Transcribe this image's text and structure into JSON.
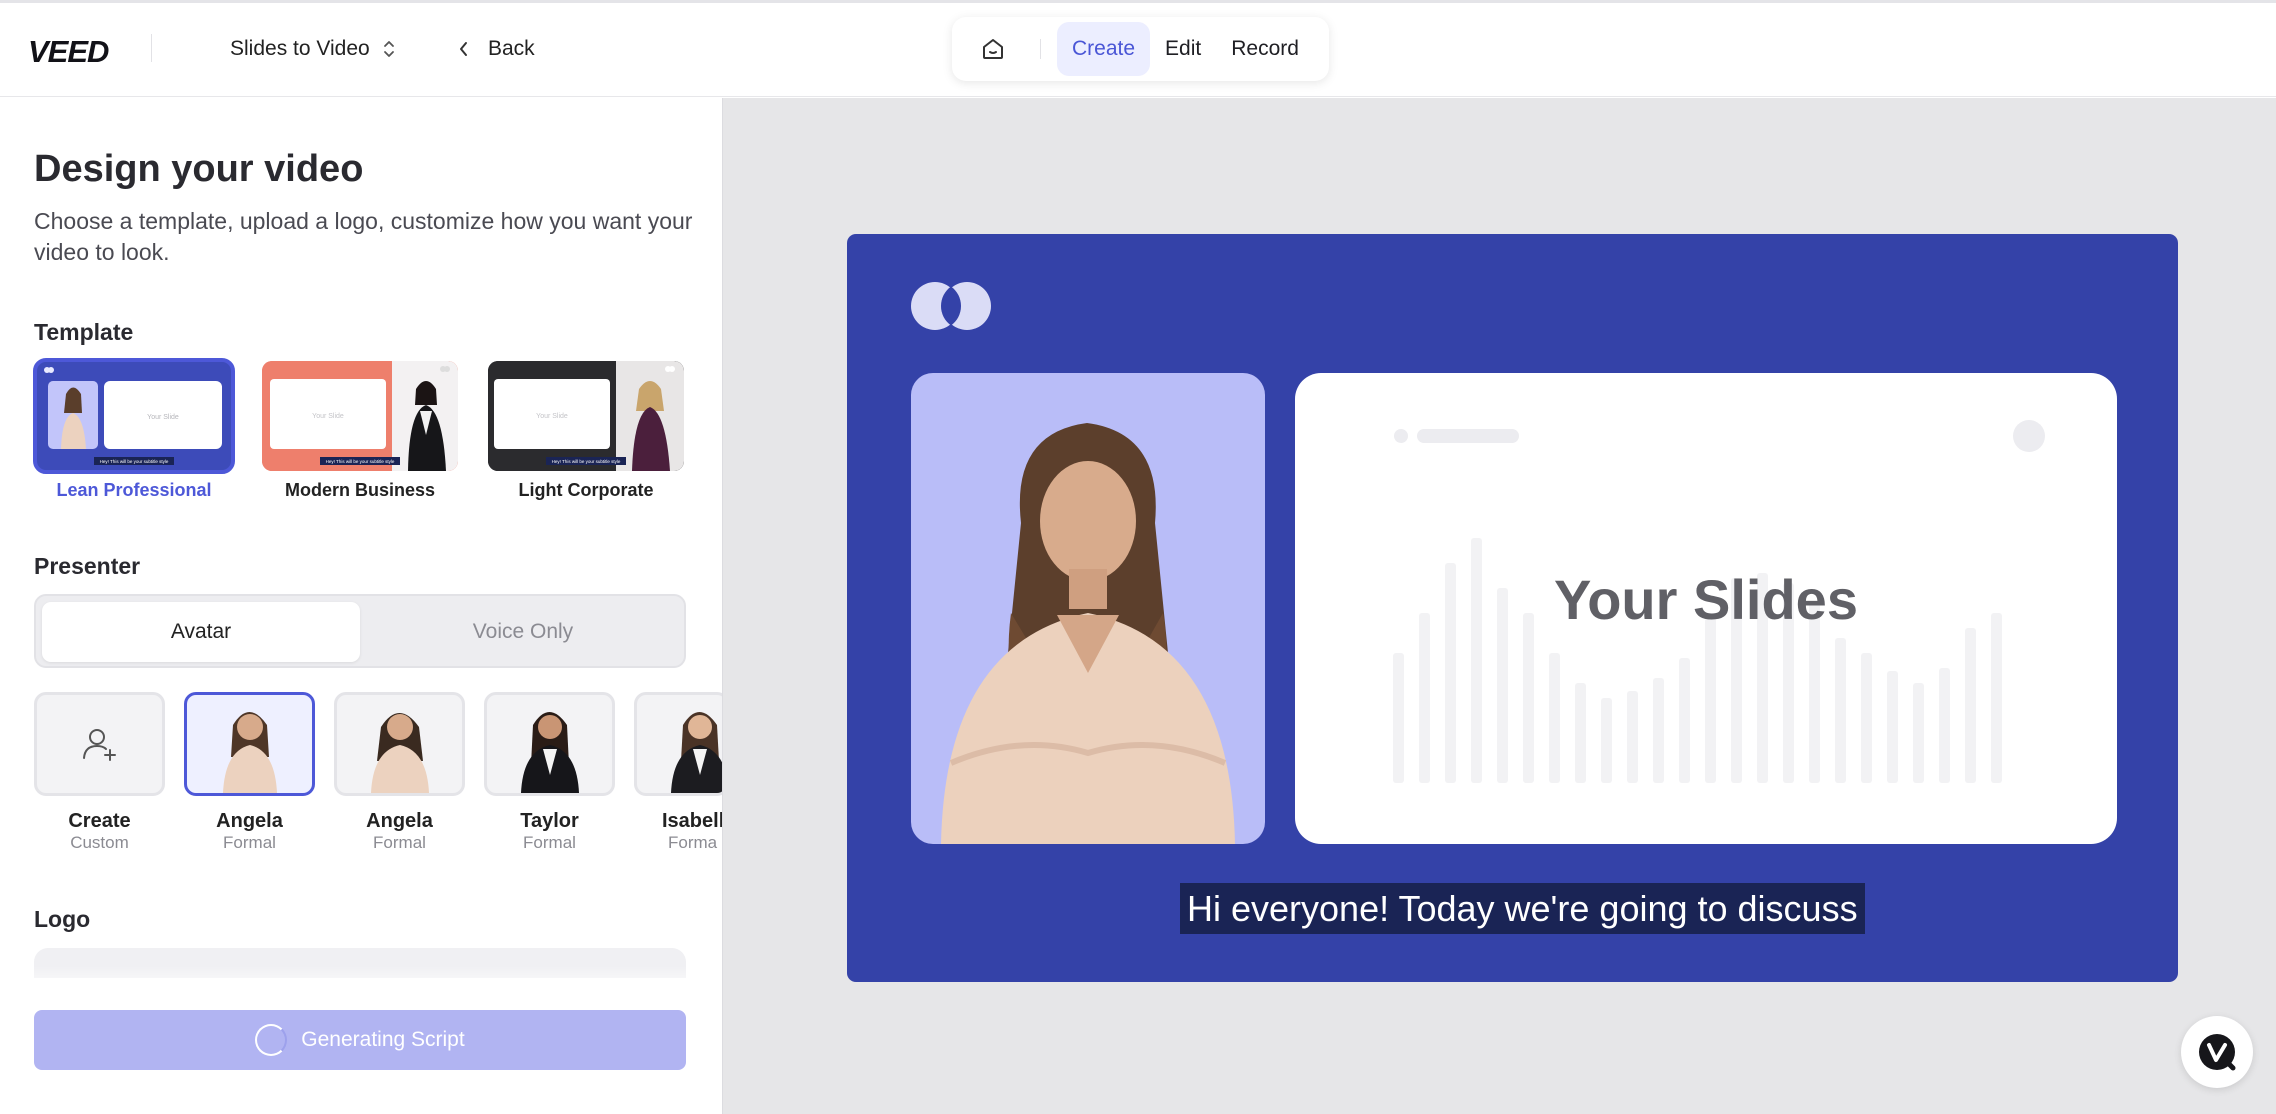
{
  "topbar": {
    "brand": "VEED",
    "project_name": "Slides to Video",
    "back_label": "Back",
    "modes": [
      {
        "label": "Create",
        "active": true
      },
      {
        "label": "Edit",
        "active": false
      },
      {
        "label": "Record",
        "active": false
      }
    ]
  },
  "panel": {
    "title": "Design your video",
    "subtitle": "Choose a template, upload a logo, customize how you want your video to look.",
    "template_heading": "Template",
    "templates": [
      {
        "label": "Lean Professional",
        "selected": true,
        "slide_text": "Your Slide"
      },
      {
        "label": "Modern Business",
        "selected": false,
        "slide_text": "Your Slide"
      },
      {
        "label": "Light Corporate",
        "selected": false,
        "slide_text": "Your Slide"
      }
    ],
    "presenter_heading": "Presenter",
    "presenter_modes": [
      "Avatar",
      "Voice Only"
    ],
    "presenter_mode_selected": "Avatar",
    "avatars": [
      {
        "name": "Create",
        "type": "Custom",
        "selected": false
      },
      {
        "name": "Angela",
        "type": "Formal",
        "selected": true
      },
      {
        "name": "Angela",
        "type": "Formal",
        "selected": false
      },
      {
        "name": "Taylor",
        "type": "Formal",
        "selected": false
      },
      {
        "name": "Isabell",
        "type": "Forma",
        "selected": false
      }
    ],
    "logo_heading": "Logo",
    "generate_label": "Generating Script"
  },
  "preview": {
    "slide_title": "Your Slides",
    "caption": "Hi everyone! Today we're going to discuss",
    "template_subtitle_text": "Hey! This will be your subtitle style"
  },
  "colors": {
    "accent": "#4d58d8",
    "canvas_bg": "#3442a8",
    "presenter_bg": "#b9bdf8",
    "generate_button": "#b1b4f2"
  }
}
